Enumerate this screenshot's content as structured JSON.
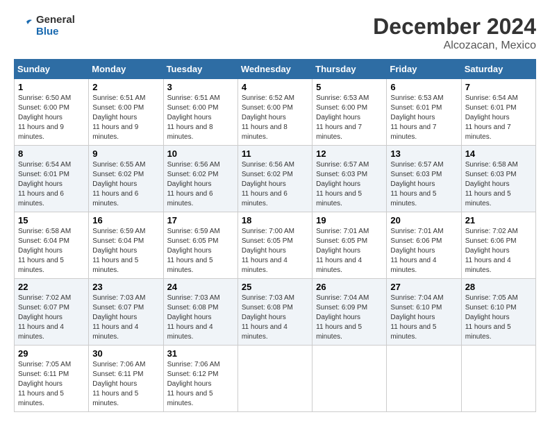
{
  "header": {
    "logo_line1": "General",
    "logo_line2": "Blue",
    "month": "December 2024",
    "location": "Alcozacan, Mexico"
  },
  "weekdays": [
    "Sunday",
    "Monday",
    "Tuesday",
    "Wednesday",
    "Thursday",
    "Friday",
    "Saturday"
  ],
  "weeks": [
    [
      {
        "day": "1",
        "sunrise": "6:50 AM",
        "sunset": "6:00 PM",
        "daylight": "11 hours and 9 minutes."
      },
      {
        "day": "2",
        "sunrise": "6:51 AM",
        "sunset": "6:00 PM",
        "daylight": "11 hours and 9 minutes."
      },
      {
        "day": "3",
        "sunrise": "6:51 AM",
        "sunset": "6:00 PM",
        "daylight": "11 hours and 8 minutes."
      },
      {
        "day": "4",
        "sunrise": "6:52 AM",
        "sunset": "6:00 PM",
        "daylight": "11 hours and 8 minutes."
      },
      {
        "day": "5",
        "sunrise": "6:53 AM",
        "sunset": "6:00 PM",
        "daylight": "11 hours and 7 minutes."
      },
      {
        "day": "6",
        "sunrise": "6:53 AM",
        "sunset": "6:01 PM",
        "daylight": "11 hours and 7 minutes."
      },
      {
        "day": "7",
        "sunrise": "6:54 AM",
        "sunset": "6:01 PM",
        "daylight": "11 hours and 7 minutes."
      }
    ],
    [
      {
        "day": "8",
        "sunrise": "6:54 AM",
        "sunset": "6:01 PM",
        "daylight": "11 hours and 6 minutes."
      },
      {
        "day": "9",
        "sunrise": "6:55 AM",
        "sunset": "6:02 PM",
        "daylight": "11 hours and 6 minutes."
      },
      {
        "day": "10",
        "sunrise": "6:56 AM",
        "sunset": "6:02 PM",
        "daylight": "11 hours and 6 minutes."
      },
      {
        "day": "11",
        "sunrise": "6:56 AM",
        "sunset": "6:02 PM",
        "daylight": "11 hours and 6 minutes."
      },
      {
        "day": "12",
        "sunrise": "6:57 AM",
        "sunset": "6:03 PM",
        "daylight": "11 hours and 5 minutes."
      },
      {
        "day": "13",
        "sunrise": "6:57 AM",
        "sunset": "6:03 PM",
        "daylight": "11 hours and 5 minutes."
      },
      {
        "day": "14",
        "sunrise": "6:58 AM",
        "sunset": "6:03 PM",
        "daylight": "11 hours and 5 minutes."
      }
    ],
    [
      {
        "day": "15",
        "sunrise": "6:58 AM",
        "sunset": "6:04 PM",
        "daylight": "11 hours and 5 minutes."
      },
      {
        "day": "16",
        "sunrise": "6:59 AM",
        "sunset": "6:04 PM",
        "daylight": "11 hours and 5 minutes."
      },
      {
        "day": "17",
        "sunrise": "6:59 AM",
        "sunset": "6:05 PM",
        "daylight": "11 hours and 5 minutes."
      },
      {
        "day": "18",
        "sunrise": "7:00 AM",
        "sunset": "6:05 PM",
        "daylight": "11 hours and 4 minutes."
      },
      {
        "day": "19",
        "sunrise": "7:01 AM",
        "sunset": "6:05 PM",
        "daylight": "11 hours and 4 minutes."
      },
      {
        "day": "20",
        "sunrise": "7:01 AM",
        "sunset": "6:06 PM",
        "daylight": "11 hours and 4 minutes."
      },
      {
        "day": "21",
        "sunrise": "7:02 AM",
        "sunset": "6:06 PM",
        "daylight": "11 hours and 4 minutes."
      }
    ],
    [
      {
        "day": "22",
        "sunrise": "7:02 AM",
        "sunset": "6:07 PM",
        "daylight": "11 hours and 4 minutes."
      },
      {
        "day": "23",
        "sunrise": "7:03 AM",
        "sunset": "6:07 PM",
        "daylight": "11 hours and 4 minutes."
      },
      {
        "day": "24",
        "sunrise": "7:03 AM",
        "sunset": "6:08 PM",
        "daylight": "11 hours and 4 minutes."
      },
      {
        "day": "25",
        "sunrise": "7:03 AM",
        "sunset": "6:08 PM",
        "daylight": "11 hours and 4 minutes."
      },
      {
        "day": "26",
        "sunrise": "7:04 AM",
        "sunset": "6:09 PM",
        "daylight": "11 hours and 5 minutes."
      },
      {
        "day": "27",
        "sunrise": "7:04 AM",
        "sunset": "6:10 PM",
        "daylight": "11 hours and 5 minutes."
      },
      {
        "day": "28",
        "sunrise": "7:05 AM",
        "sunset": "6:10 PM",
        "daylight": "11 hours and 5 minutes."
      }
    ],
    [
      {
        "day": "29",
        "sunrise": "7:05 AM",
        "sunset": "6:11 PM",
        "daylight": "11 hours and 5 minutes."
      },
      {
        "day": "30",
        "sunrise": "7:06 AM",
        "sunset": "6:11 PM",
        "daylight": "11 hours and 5 minutes."
      },
      {
        "day": "31",
        "sunrise": "7:06 AM",
        "sunset": "6:12 PM",
        "daylight": "11 hours and 5 minutes."
      },
      null,
      null,
      null,
      null
    ]
  ],
  "labels": {
    "sunrise": "Sunrise:",
    "sunset": "Sunset:",
    "daylight": "Daylight hours"
  }
}
